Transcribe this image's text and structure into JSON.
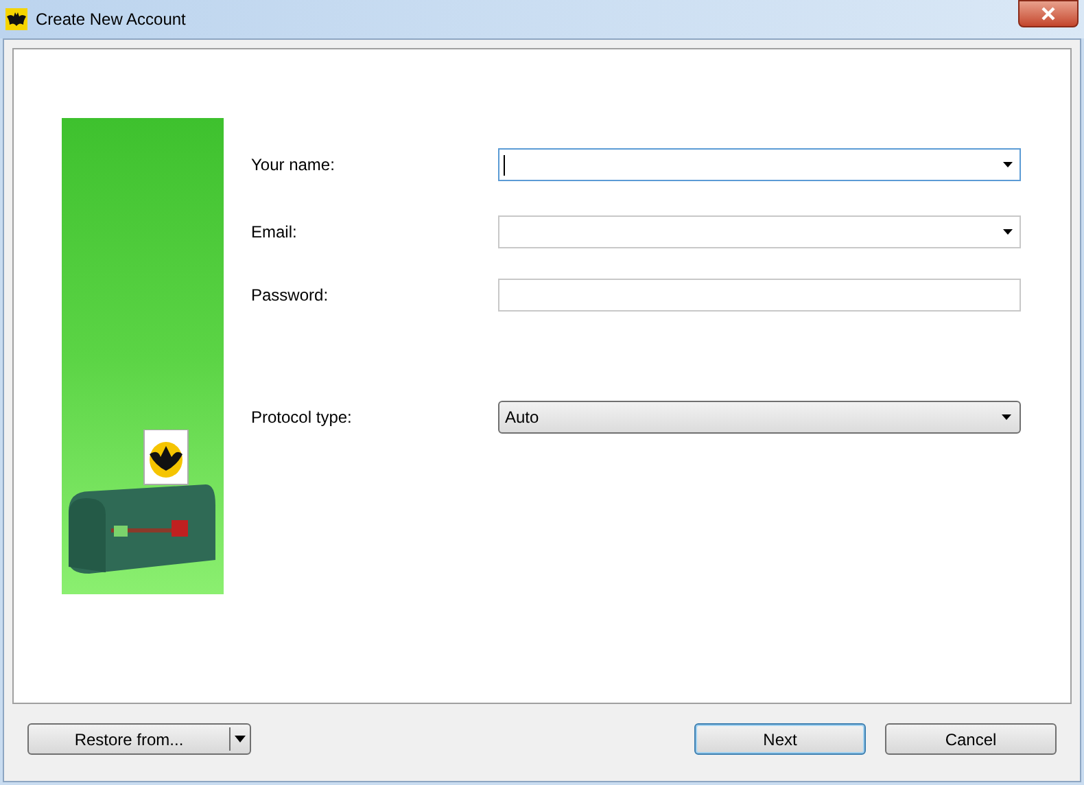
{
  "window": {
    "title": "Create New Account"
  },
  "fields": [
    {
      "label": "Your name:",
      "kind": "combo",
      "focused": true
    },
    {
      "label": "Email:",
      "kind": "combo",
      "focused": false
    },
    {
      "label": "Password:",
      "kind": "text",
      "focused": false
    },
    {
      "label": "Protocol type:",
      "kind": "dropdown",
      "focused": false,
      "value": "Auto"
    }
  ],
  "buttons": [
    {
      "label": "Restore from...",
      "kind": "split"
    },
    {
      "label": "Next",
      "kind": "default"
    },
    {
      "label": "Cancel",
      "kind": "plain"
    }
  ]
}
